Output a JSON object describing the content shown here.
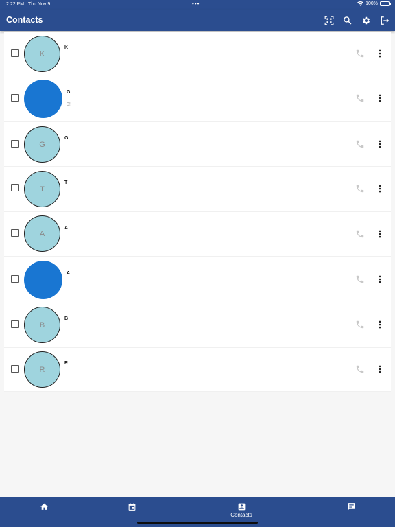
{
  "status_bar": {
    "time": "2:22 PM",
    "date": "Thu Nov 9",
    "battery": "100%",
    "battery_level": 1.0,
    "dots": "•••"
  },
  "app_bar": {
    "title": "Contacts",
    "actions": [
      "qr-scan-icon",
      "search-icon",
      "gear-icon",
      "logout-icon"
    ]
  },
  "contacts": [
    {
      "initial": "K",
      "name": "K",
      "sub": "",
      "avatar": "light"
    },
    {
      "initial": "",
      "name": "G",
      "sub": "0!",
      "avatar": "dark"
    },
    {
      "initial": "G",
      "name": "G",
      "sub": "",
      "avatar": "light"
    },
    {
      "initial": "T",
      "name": "T",
      "sub": "",
      "avatar": "light"
    },
    {
      "initial": "A",
      "name": "A",
      "sub": "",
      "avatar": "light"
    },
    {
      "initial": "",
      "name": "A",
      "sub": "",
      "avatar": "dark"
    },
    {
      "initial": "B",
      "name": "B",
      "sub": "",
      "avatar": "light"
    },
    {
      "initial": "R",
      "name": "R",
      "sub": "",
      "avatar": "light"
    }
  ],
  "bottom_nav": [
    {
      "icon": "home-icon",
      "label": ""
    },
    {
      "icon": "calendar-icon",
      "label": ""
    },
    {
      "icon": "contacts-icon",
      "label": "Contacts",
      "active": true
    },
    {
      "icon": "chat-icon",
      "label": ""
    }
  ],
  "colors": {
    "primary": "#2b4d8f",
    "avatar_light": "#9fd4de",
    "avatar_dark": "#1976d2"
  }
}
